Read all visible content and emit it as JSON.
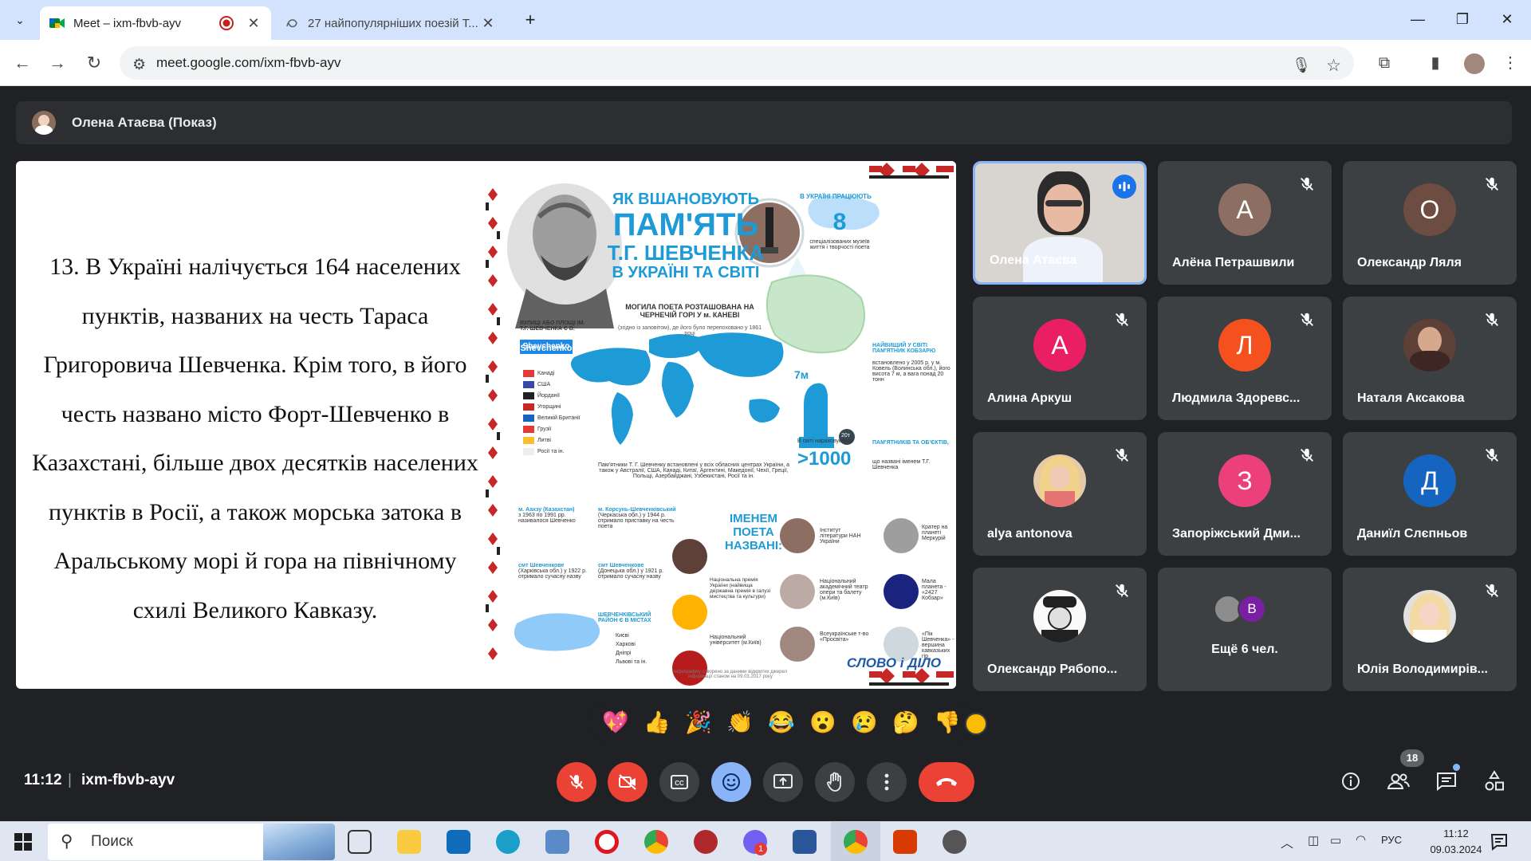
{
  "browser": {
    "tabs": [
      {
        "title": "Meet – ixm-fbvb-ayv",
        "active": true,
        "recording": true
      },
      {
        "title": "27 найпопулярніших поезій Т...",
        "active": false
      }
    ],
    "url": "meet.google.com/ixm-fbvb-ayv"
  },
  "presenter": {
    "label": "Олена Атаєва (Показ)"
  },
  "slide": {
    "text": "13. В Україні налічується 164 населених пунктів, названих на честь Тараса Григоровича Шевченка. Крім того, в його честь названо місто Форт-Шевченко в Казахстані, більше двох десятків населених пунктів в Росії, а також морська затока в Аральському морі й гора на північному схилі Великого Кавказу.",
    "infographic": {
      "title1": "ЯК ВШАНОВУЮТЬ",
      "title2": "ПАМ'ЯТЬ",
      "title3": "Т.Г. ШЕВЧЕНКА",
      "title4": "В УКРАЇНІ ТА СВІТІ",
      "museums_head": "В УКРАЇНІ ПРАЦЮЮТЬ",
      "museums_num": "8",
      "museums_sub": "спеціалізованих музеїв життя і творчості поета",
      "grave": "МОГИЛА ПОЕТА РОЗТАШОВАНА НА ЧЕРНЕЧІЙ ГОРІ У м. КАНЕВІ",
      "grave_sub": "(згідно із заповітом), де його було перепоховано у 1861 році",
      "streets_head": "ВУЛИЦІ АБО ПЛОЩІ ІМ. Т.Г. ШЕВЧЕНКА Є В:",
      "sign": "Shevchenko",
      "countries": [
        "Канаді",
        "США",
        "Йорданії",
        "Угорщині",
        "Великій Британії",
        "Грузії",
        "Литві",
        "Росії та ін."
      ],
      "monument_h": "7м",
      "monument_t": "20т",
      "biggest": "НАЙВИЩИЙ У СВІТІ ПАМ'ЯТНИК КОБЗАРЮ",
      "biggest_sub": "встановлено у 2005 р. у м. Ковель (Волинська обл.), його висота 7 м, а вага понад 20 тонн",
      "monuments_count": ">1000",
      "monuments_pre": "В світі нараховується",
      "monuments_head": "ПАМ'ЯТНИКІВ ТА ОБ'ЄКТІВ,",
      "monuments_sub": "що названі іменем Т.Г. Шевченка",
      "regions": "Пам'ятники Т. Г. Шевченку встановлені у всіх обласних центрах України, а також у Австралії, США, Канаді, Китаї, Аргентині, Македонії, Чехії, Греції, Польщі, Азербайджані, Узбекистані, Росії та ін.",
      "named_head": "ІМЕНЕМ ПОЕТА НАЗВАНІ:",
      "place1_name": "м. Аахзу (Казахстан)",
      "place1_txt": "з 1963 по 1991 рр. називалося Шевченко",
      "place2_name": "м. Корсунь-Шевченківський",
      "place2_txt": "(Черкаська обл.) у 1944 р. отримало приставку на честь поета",
      "place3_name": "смт Шевченкове",
      "place3_txt": "(Харківська обл.) у 1922 р. отримало сучасну назву",
      "place4_name": "смт Шевченкове",
      "place4_txt": "(Донецька обл.) у 1921 р. отримало сучасну назву",
      "districts_head": "ШЕВЧЕНКІВСЬКИЙ РАЙОН Є В МІСТАХ",
      "districts": [
        "Києві",
        "Харкові",
        "Дніпрі",
        "Львові та ін."
      ],
      "named1": "Інститут літератури НАН України",
      "named2": "Кратер на планеті Меркурій",
      "named3": "Національна премія України (найвища державна премія в галузі мистецтва та культури)",
      "named4": "Національний академічний театр опери та балету (м.Київ)",
      "named5": "Мала планета - «2427 Кобзар»",
      "named6": "Національний університет (м.Київ)",
      "named7": "Всеукраїнське т-во «Просвіта»",
      "named8": "«Пік Шевченка» - вершина кавказьких гір",
      "source": "Інфографіку створено за даними відкритих джерел інформації станом на 09.03.2017 року",
      "brand": "СЛОВО і ДІЛО"
    }
  },
  "participants": [
    {
      "name": "Олена Атаєва",
      "type": "video",
      "speaking": true
    },
    {
      "name": "Алёна Петрашвили",
      "letter": "А",
      "color": "#8d6e63",
      "muted": true
    },
    {
      "name": "Олександр Ляля",
      "letter": "О",
      "color": "#6d4c41",
      "muted": true
    },
    {
      "name": "Алина Аркуш",
      "letter": "А",
      "color": "#e91e63",
      "muted": true
    },
    {
      "name": "Людмила Здоревс...",
      "letter": "Л",
      "color": "#f4511e",
      "muted": true
    },
    {
      "name": "Наталя Аксакова",
      "photo": "woman-dark-hair",
      "muted": true
    },
    {
      "name": "alya antonova",
      "photo": "woman-blonde",
      "muted": true
    },
    {
      "name": "Запоріжський Дми...",
      "letter": "З",
      "color": "#ec407a",
      "muted": true
    },
    {
      "name": "Даниїл Слєпньов",
      "letter": "Д",
      "color": "#1565c0",
      "muted": true
    },
    {
      "name": "Олександр Рябопо...",
      "photo": "cartoon-man-hat",
      "muted": true
    },
    {
      "name": "Ещё 6 чел.",
      "letter": "B",
      "color": "#7b1fa2",
      "more": true
    },
    {
      "name": "Юлія Володимирів...",
      "photo": "woman-blonde-2",
      "muted": true
    }
  ],
  "reactions": [
    "💖",
    "👍",
    "🎉",
    "👏",
    "😂",
    "😮",
    "😢",
    "🤔",
    "👎"
  ],
  "meeting": {
    "time": "11:12",
    "separator": "|",
    "code": "ixm-fbvb-ayv",
    "people_count": "18"
  },
  "taskbar": {
    "search": "Поиск",
    "lang": "РУС",
    "time": "11:12",
    "date": "09.03.2024",
    "viber_badge": "1"
  },
  "colors": {
    "end_call": "#ea4335",
    "accent": "#8ab4f8",
    "infographic_blue": "#1e9ad6",
    "infographic_red": "#c62828"
  }
}
